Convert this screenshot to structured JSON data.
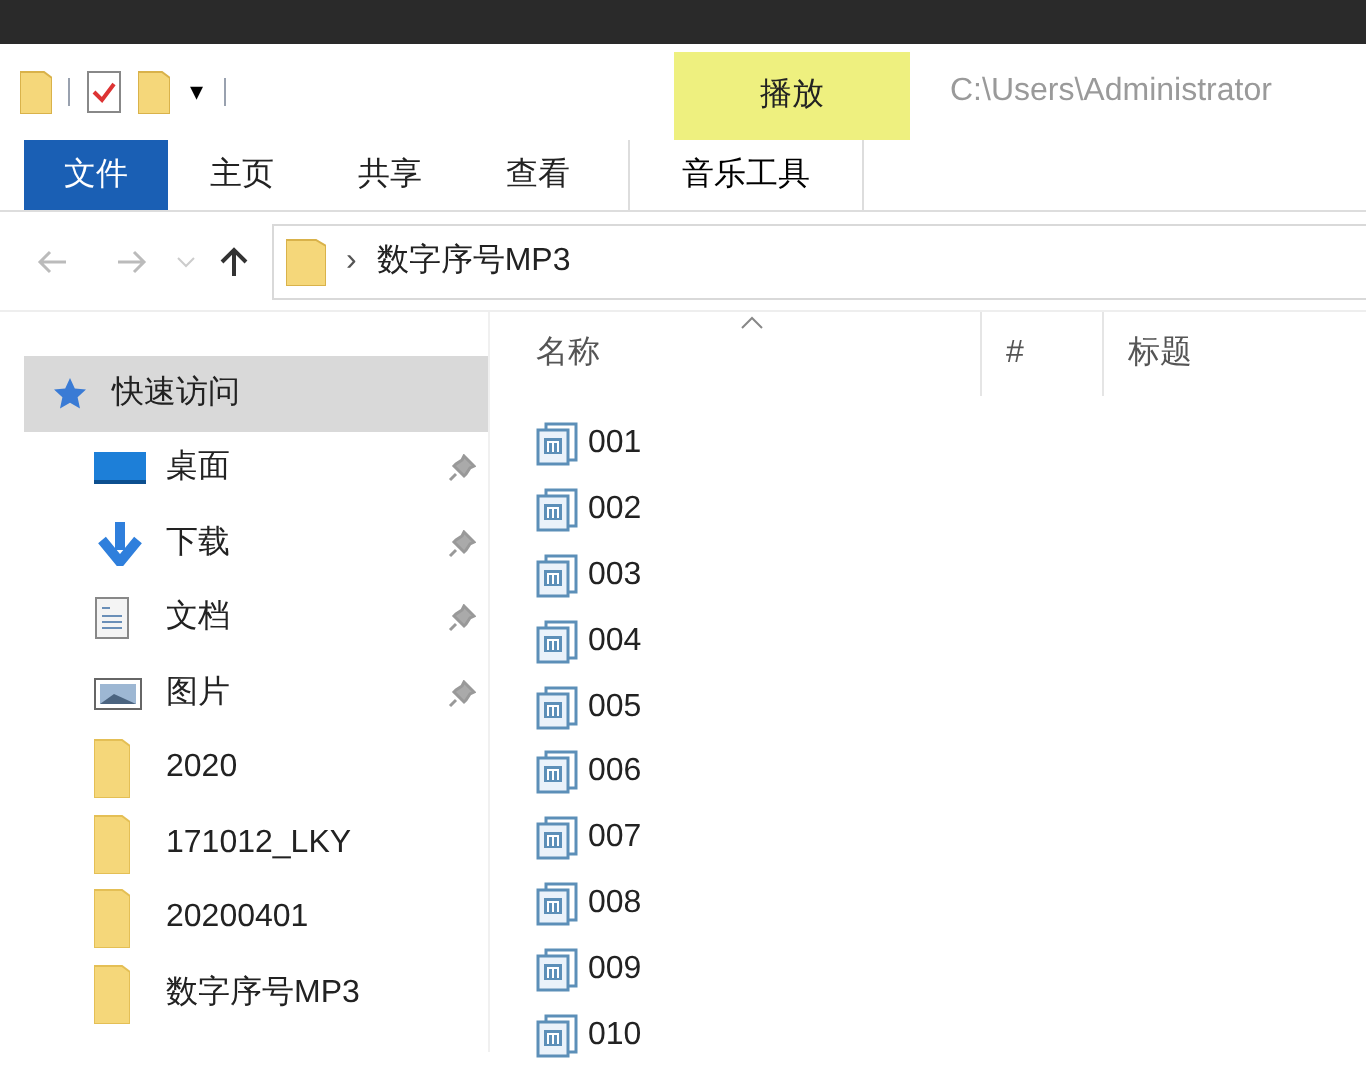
{
  "quick_access_toolbar": {
    "customize_glyph": "▾"
  },
  "ribbon": {
    "context_tab_group": "播放",
    "path_title": "C:\\Users\\Administrator",
    "tabs": [
      {
        "label": "文件",
        "kind": "file",
        "selected": false
      },
      {
        "label": "主页",
        "kind": "tab",
        "selected": false
      },
      {
        "label": "共享",
        "kind": "tab",
        "selected": false
      },
      {
        "label": "查看",
        "kind": "tab",
        "selected": false
      },
      {
        "label": "音乐工具",
        "kind": "context",
        "selected": false
      }
    ]
  },
  "address_bar": {
    "separator": "›",
    "location": "数字序号MP3"
  },
  "sidebar": {
    "items": [
      {
        "label": "快速访问",
        "kind": "star",
        "pinned": false,
        "selected": true
      },
      {
        "label": "桌面",
        "kind": "desktop",
        "pinned": true,
        "selected": false
      },
      {
        "label": "下载",
        "kind": "download",
        "pinned": true,
        "selected": false
      },
      {
        "label": "文档",
        "kind": "document",
        "pinned": true,
        "selected": false
      },
      {
        "label": "图片",
        "kind": "pictures",
        "pinned": true,
        "selected": false
      },
      {
        "label": "2020",
        "kind": "folder",
        "pinned": false,
        "selected": false
      },
      {
        "label": "171012_LKY",
        "kind": "folder",
        "pinned": false,
        "selected": false
      },
      {
        "label": "20200401",
        "kind": "folder",
        "pinned": false,
        "selected": false
      },
      {
        "label": "数字序号MP3",
        "kind": "folder",
        "pinned": false,
        "selected": false
      }
    ]
  },
  "file_list": {
    "columns": [
      {
        "label": "名称",
        "sorted": true
      },
      {
        "label": "#",
        "sorted": false
      },
      {
        "label": "标题",
        "sorted": false
      }
    ],
    "rows": [
      {
        "name": "001"
      },
      {
        "name": "002"
      },
      {
        "name": "003"
      },
      {
        "name": "004"
      },
      {
        "name": "005"
      },
      {
        "name": "006"
      },
      {
        "name": "007"
      },
      {
        "name": "008"
      },
      {
        "name": "009"
      },
      {
        "name": "010"
      }
    ]
  }
}
